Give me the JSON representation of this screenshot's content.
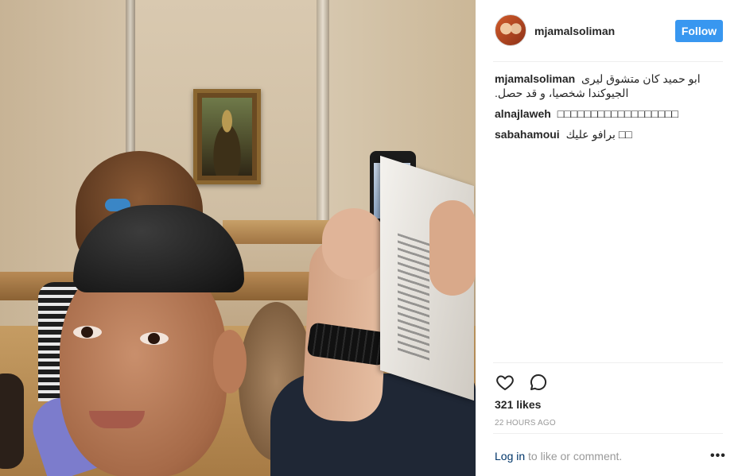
{
  "post": {
    "username": "mjamalsoliman",
    "follow_label": "Follow",
    "caption": {
      "user": "mjamalsoliman",
      "text": "ابو حميد كان متشوق ليرى الجيوكندا شخصيا، و قد حصل."
    },
    "comments": [
      {
        "user": "alnajlaweh",
        "text": "□□□□□□□□□□□□□□□□□□"
      },
      {
        "user": "sabahamoui",
        "text": "برافو عليك □□"
      }
    ],
    "likes_text": "321 likes",
    "time_text": "22 HOURS AGO",
    "footer": {
      "login_link": "Log in",
      "rest_text": " to like or comment.",
      "more_label": "•••"
    },
    "icons": [
      "heart-icon",
      "comment-icon"
    ],
    "colors": {
      "follow_bg": "#3897f0",
      "link": "#003569",
      "muted": "#999999"
    }
  }
}
